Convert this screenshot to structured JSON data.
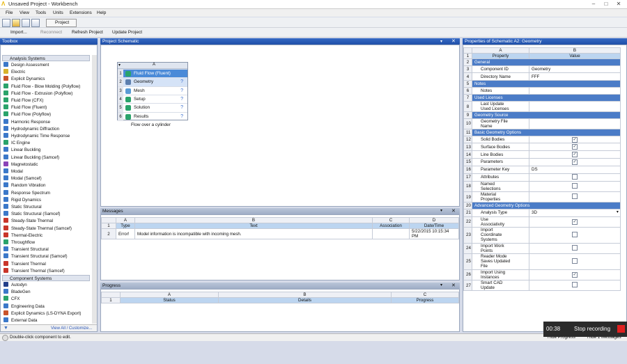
{
  "window": {
    "title": "Unsaved Project - Workbench",
    "min": "–",
    "max": "□",
    "close": "✕"
  },
  "menu": [
    "File",
    "View",
    "Tools",
    "Units",
    "Extensions",
    "Help"
  ],
  "toolbar": {
    "project_label": "Project",
    "import_label": "Import...",
    "reconnect_label": "Reconnect",
    "refresh_label": "Refresh Project",
    "update_label": "Update Project"
  },
  "toolbox": {
    "title": "Toolbox",
    "analysis_systems_label": "Analysis Systems",
    "analysis_systems": [
      {
        "label": "Design Assessment",
        "color": "#3b78c9"
      },
      {
        "label": "Electric",
        "color": "#d8b22a"
      },
      {
        "label": "Explicit Dynamics",
        "color": "#c9532a"
      },
      {
        "label": "Fluid Flow - Blow Molding (Polyflow)",
        "color": "#2aa36b"
      },
      {
        "label": "Fluid Flow - Extrusion (Polyflow)",
        "color": "#2aa36b"
      },
      {
        "label": "Fluid Flow (CFX)",
        "color": "#2aa36b"
      },
      {
        "label": "Fluid Flow (Fluent)",
        "color": "#2aa36b"
      },
      {
        "label": "Fluid Flow (Polyflow)",
        "color": "#2aa36b"
      },
      {
        "label": "Harmonic Response",
        "color": "#3b78c9"
      },
      {
        "label": "Hydrodynamic Diffraction",
        "color": "#3b78c9"
      },
      {
        "label": "Hydrodynamic Time Response",
        "color": "#3b78c9"
      },
      {
        "label": "IC Engine",
        "color": "#2aa36b"
      },
      {
        "label": "Linear Buckling",
        "color": "#3b78c9"
      },
      {
        "label": "Linear Buckling (Samcef)",
        "color": "#3b78c9"
      },
      {
        "label": "Magnetostatic",
        "color": "#8a44b8"
      },
      {
        "label": "Modal",
        "color": "#3b78c9"
      },
      {
        "label": "Modal (Samcef)",
        "color": "#3b78c9"
      },
      {
        "label": "Random Vibration",
        "color": "#3b78c9"
      },
      {
        "label": "Response Spectrum",
        "color": "#3b78c9"
      },
      {
        "label": "Rigid Dynamics",
        "color": "#3b78c9"
      },
      {
        "label": "Static Structural",
        "color": "#3b78c9"
      },
      {
        "label": "Static Structural (Samcef)",
        "color": "#3b78c9"
      },
      {
        "label": "Steady-State Thermal",
        "color": "#c9352a"
      },
      {
        "label": "Steady-State Thermal (Samcef)",
        "color": "#c9352a"
      },
      {
        "label": "Thermal-Electric",
        "color": "#c9352a"
      },
      {
        "label": "Throughflow",
        "color": "#2aa36b"
      },
      {
        "label": "Transient Structural",
        "color": "#3b78c9"
      },
      {
        "label": "Transient Structural (Samcef)",
        "color": "#3b78c9"
      },
      {
        "label": "Transient Thermal",
        "color": "#c9352a"
      },
      {
        "label": "Transient Thermal (Samcef)",
        "color": "#c9352a"
      }
    ],
    "component_systems_label": "Component Systems",
    "component_systems": [
      {
        "label": "Autodyn",
        "color": "#24408a"
      },
      {
        "label": "BladeGen",
        "color": "#3b78c9"
      },
      {
        "label": "CFX",
        "color": "#2aa36b"
      },
      {
        "label": "Engineering Data",
        "color": "#3b78c9"
      },
      {
        "label": "Explicit Dynamics (LS-DYNA Export)",
        "color": "#c9532a"
      },
      {
        "label": "External Data",
        "color": "#3b78c9"
      }
    ],
    "footer": {
      "filter_icon": "funnel-icon",
      "view_all": "View All / Customize..."
    }
  },
  "schematic": {
    "title": "Project Schematic",
    "system": {
      "column": "A",
      "rows": [
        {
          "num": "1",
          "label": "Fluid Flow (Fluent)",
          "color": "#2aa36b",
          "status": ""
        },
        {
          "num": "2",
          "label": "Geometry",
          "color": "#5d7fae",
          "status": "?"
        },
        {
          "num": "3",
          "label": "Mesh",
          "color": "#5a9bd5",
          "status": "?"
        },
        {
          "num": "4",
          "label": "Setup",
          "color": "#2aa36b",
          "status": "?"
        },
        {
          "num": "5",
          "label": "Solution",
          "color": "#2aa36b",
          "status": "?"
        },
        {
          "num": "6",
          "label": "Results",
          "color": "#2aa36b",
          "status": "?"
        }
      ],
      "name": "Flow over a cylinder"
    }
  },
  "messages": {
    "title": "Messages",
    "columns": [
      "A",
      "B",
      "C",
      "D"
    ],
    "headers": [
      "Type",
      "Text",
      "Association",
      "Date/Time"
    ],
    "rows": [
      {
        "num": "2",
        "type": "Error!",
        "text": "Model information is incompatible with incoming mesh.",
        "assoc": "",
        "date": "5/22/2015 10:15:34 PM"
      }
    ]
  },
  "progress": {
    "title": "Progress",
    "columns": [
      "A",
      "B",
      "C"
    ],
    "headers": [
      "Status",
      "Details",
      "Progress"
    ]
  },
  "properties": {
    "title": "Properties of Schematic A2: Geometry",
    "columns": [
      "A",
      "B"
    ],
    "headers": [
      "Property",
      "Value"
    ],
    "rows": [
      {
        "n": "2",
        "kind": "section",
        "label": "General"
      },
      {
        "n": "3",
        "kind": "text",
        "label": "Component ID",
        "value": "Geometry"
      },
      {
        "n": "4",
        "kind": "text",
        "label": "Directory Name",
        "value": "FFF"
      },
      {
        "n": "5",
        "kind": "section",
        "label": "Notes"
      },
      {
        "n": "6",
        "kind": "text",
        "label": "Notes",
        "value": ""
      },
      {
        "n": "7",
        "kind": "section",
        "label": "Used Licenses"
      },
      {
        "n": "8",
        "kind": "text",
        "label": "Last Update\nUsed Licenses",
        "value": ""
      },
      {
        "n": "9",
        "kind": "section",
        "label": "Geometry Source"
      },
      {
        "n": "10",
        "kind": "text",
        "label": "Geometry File\nName",
        "value": ""
      },
      {
        "n": "11",
        "kind": "section",
        "label": "Basic Geometry Options"
      },
      {
        "n": "12",
        "kind": "check",
        "label": "Solid Bodies",
        "value": true
      },
      {
        "n": "13",
        "kind": "check",
        "label": "Surface Bodies",
        "value": true
      },
      {
        "n": "14",
        "kind": "check",
        "label": "Line Bodies",
        "value": true
      },
      {
        "n": "15",
        "kind": "check",
        "label": "Parameters",
        "value": true
      },
      {
        "n": "16",
        "kind": "text",
        "label": "Parameter Key",
        "value": "DS"
      },
      {
        "n": "17",
        "kind": "check",
        "label": "Attributes",
        "value": false
      },
      {
        "n": "18",
        "kind": "check",
        "label": "Named\nSelections",
        "value": false
      },
      {
        "n": "19",
        "kind": "check",
        "label": "Material\nProperties",
        "value": false
      },
      {
        "n": "20",
        "kind": "section",
        "label": "Advanced Geometry Options"
      },
      {
        "n": "21",
        "kind": "select",
        "label": "Analysis Type",
        "value": "3D"
      },
      {
        "n": "22",
        "kind": "check",
        "label": "Use\nAssociativity",
        "value": true
      },
      {
        "n": "23",
        "kind": "check",
        "label": "Import\nCoordinate\nSystems",
        "value": false
      },
      {
        "n": "24",
        "kind": "check",
        "label": "Import Work\nPoints",
        "value": false
      },
      {
        "n": "25",
        "kind": "check",
        "label": "Reader Mode\nSaves Updated\nFile",
        "value": false
      },
      {
        "n": "26",
        "kind": "check",
        "label": "Import Using\nInstances",
        "value": true
      },
      {
        "n": "27",
        "kind": "check",
        "label": "Smart CAD\nUpdate",
        "value": false
      }
    ]
  },
  "status": {
    "text": "Double-click component to edit.",
    "hide_progress": "Hide Progress",
    "hide_messages": "Hide 1 Messages"
  },
  "recording": {
    "time": "00:38",
    "label": "Stop recording"
  }
}
